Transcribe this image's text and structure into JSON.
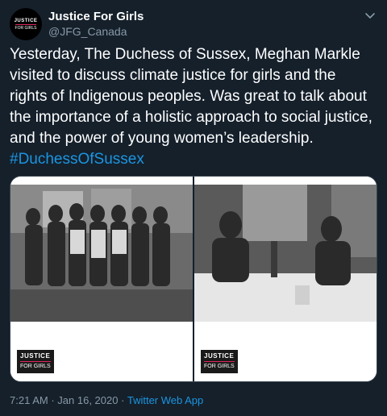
{
  "user": {
    "avatar_line1": "JUSTICE",
    "avatar_line2": "FOR GIRLS",
    "display_name": "Justice For Girls",
    "handle": "@JFG_Canada"
  },
  "tweet": {
    "text": "Yesterday, The Duchess of Sussex, Meghan Markle visited to discuss climate justice for girls and the rights of Indigenous peoples. Was great to talk about the importance of a holistic approach to social justice, and the power of young women’s leadership.",
    "hashtag": "#DuchessOfSussex"
  },
  "media": {
    "photo1_badge_line1": "JUSTICE",
    "photo1_badge_line2": "FOR GIRLS",
    "photo2_badge_line1": "JUSTICE",
    "photo2_badge_line2": "FOR GIRLS"
  },
  "meta": {
    "time": "7:21 AM",
    "date": "Jan 16, 2020",
    "separator": "·",
    "app": "Twitter Web App"
  },
  "colors": {
    "background": "#15202b",
    "secondary_text": "#8899a6",
    "link": "#1b95e0"
  }
}
